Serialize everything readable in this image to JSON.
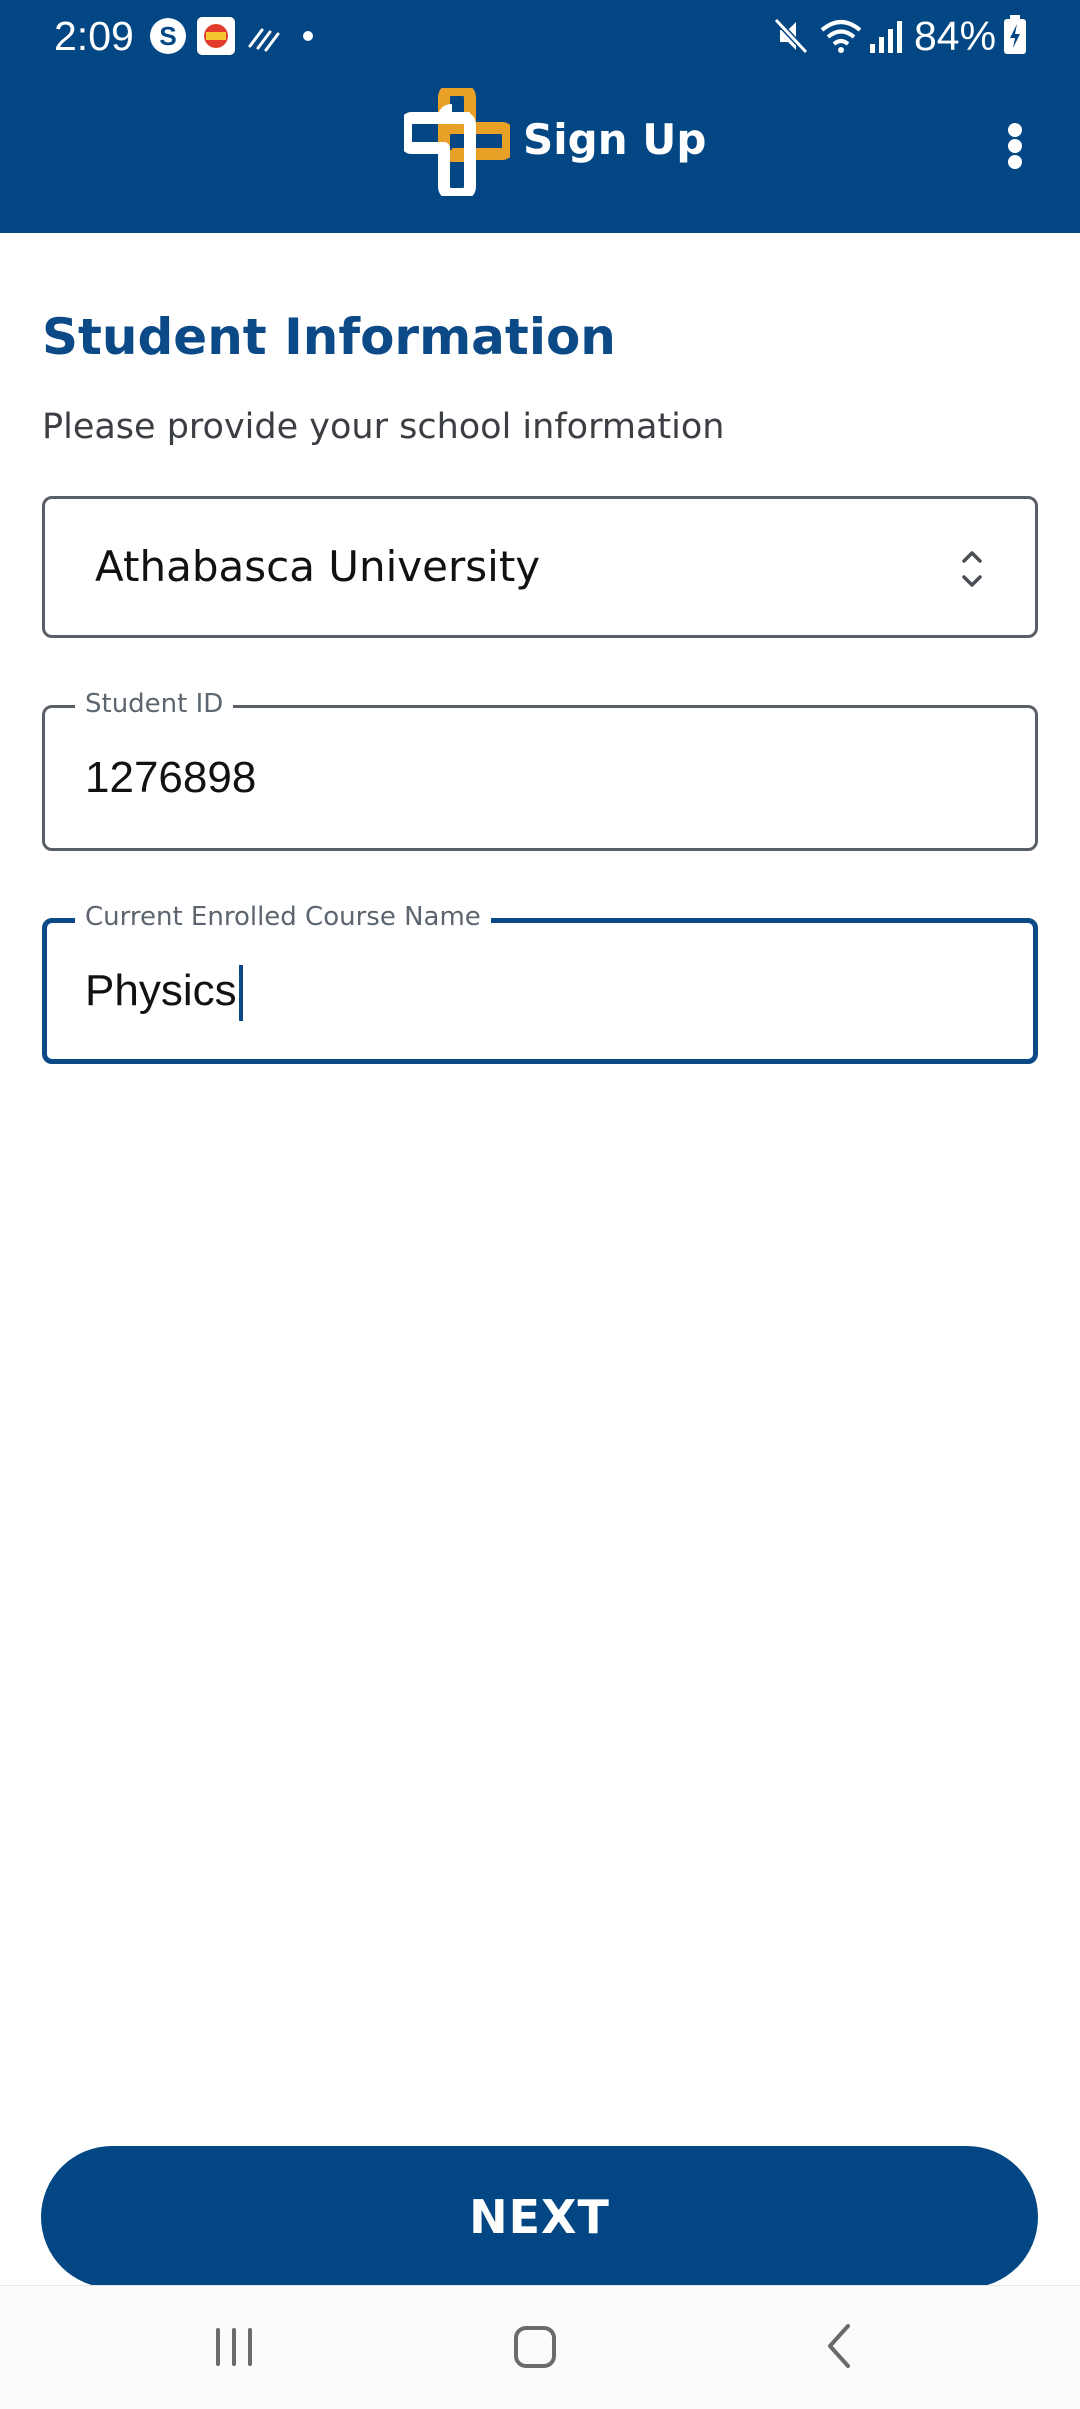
{
  "status_bar": {
    "time": "2:09",
    "battery": "84%",
    "icons": [
      "skype-icon",
      "game-app-icon",
      "signal-waves-icon",
      "dot-icon",
      "mute-icon",
      "wifi-icon",
      "cell-signal-icon",
      "battery-charging-icon"
    ]
  },
  "app_bar": {
    "title": "Sign Up",
    "logo_icon": "cross-logo-icon",
    "menu_icon": "more-vertical-icon",
    "colors": {
      "background": "#024784",
      "logo_accent": "#E8A027"
    }
  },
  "page": {
    "title": "Student Information",
    "subtitle": "Please provide your school information"
  },
  "form": {
    "school": {
      "value": "Athabasca University",
      "icon": "up-down-arrows-icon"
    },
    "student_id": {
      "label": "Student ID",
      "value": "1276898"
    },
    "course": {
      "label": "Current Enrolled Course Name",
      "value": "Physics",
      "focused": true
    }
  },
  "actions": {
    "next_label": "NEXT"
  },
  "nav_bar": {
    "items": [
      "recents-icon",
      "home-icon",
      "back-icon"
    ]
  }
}
